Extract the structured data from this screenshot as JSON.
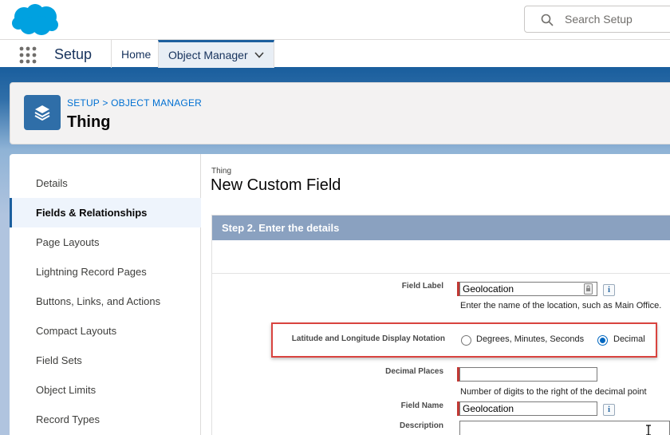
{
  "search": {
    "placeholder": "Search Setup"
  },
  "nav": {
    "app_name": "Setup",
    "tabs": [
      {
        "label": "Home"
      },
      {
        "label": "Object Manager"
      }
    ]
  },
  "page_header": {
    "breadcrumb_setup": "SETUP",
    "breadcrumb_sep": ">",
    "breadcrumb_om": "OBJECT MANAGER",
    "title": "Thing"
  },
  "sidebar": {
    "items": [
      {
        "label": "Details"
      },
      {
        "label": "Fields & Relationships"
      },
      {
        "label": "Page Layouts"
      },
      {
        "label": "Lightning Record Pages"
      },
      {
        "label": "Buttons, Links, and Actions"
      },
      {
        "label": "Compact Layouts"
      },
      {
        "label": "Field Sets"
      },
      {
        "label": "Object Limits"
      },
      {
        "label": "Record Types"
      }
    ],
    "active_index": 1
  },
  "content": {
    "object_name": "Thing",
    "title": "New Custom Field",
    "step_title": "Step 2. Enter the details"
  },
  "form": {
    "field_label": {
      "label": "Field Label",
      "value": "Geolocation",
      "help": "Enter the name of the location, such as Main Office."
    },
    "notation": {
      "label": "Latitude and Longitude Display Notation",
      "options": [
        {
          "label": "Degrees, Minutes, Seconds",
          "checked": false
        },
        {
          "label": "Decimal",
          "checked": true
        }
      ]
    },
    "decimal_places": {
      "label": "Decimal Places",
      "value": "",
      "help": "Number of digits to the right of the decimal point"
    },
    "field_name": {
      "label": "Field Name",
      "value": "Geolocation"
    },
    "description": {
      "label": "Description",
      "value": ""
    }
  },
  "colors": {
    "brand_blue": "#1b5f9e",
    "salesforce_cloud": "#00a1e0",
    "required": "#c23934",
    "highlight": "#d9433f"
  },
  "icons": {
    "logo": "salesforce-cloud-logo",
    "search": "search-icon",
    "launcher": "app-launcher-icon",
    "chevron": "chevron-down-icon",
    "object": "layers-icon",
    "info": "info-icon",
    "lock": "lock-icon"
  }
}
